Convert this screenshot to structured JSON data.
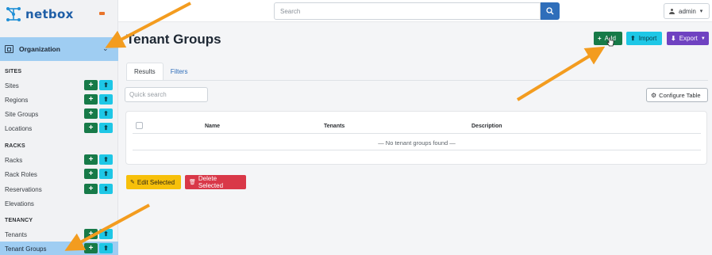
{
  "app": {
    "brand": "netbox"
  },
  "topbar": {
    "search_placeholder": "Search",
    "user": "admin"
  },
  "sidebar": {
    "menu_title": "Organization",
    "sections": [
      {
        "title": "SITES",
        "items": [
          "Sites",
          "Regions",
          "Site Groups",
          "Locations"
        ]
      },
      {
        "title": "RACKS",
        "items": [
          "Racks",
          "Rack Roles",
          "Reservations",
          "Elevations"
        ]
      },
      {
        "title": "TENANCY",
        "items": [
          "Tenants",
          "Tenant Groups"
        ]
      }
    ],
    "active_item": "Tenant Groups",
    "add_glyph": "+",
    "import_glyph": "⬆"
  },
  "page": {
    "title": "Tenant Groups",
    "actions": {
      "add": "Add",
      "import": "Import",
      "export": "Export"
    },
    "tabs": [
      "Results",
      "Filters"
    ],
    "quick_search_placeholder": "Quick search",
    "configure_table": "Configure Table",
    "table": {
      "columns": [
        "Name",
        "Tenants",
        "Description"
      ],
      "empty_message": "— No tenant groups found —"
    },
    "bulk": {
      "edit": "Edit Selected",
      "delete": "Delete Selected"
    }
  },
  "colors": {
    "brand": "#1f5fa7",
    "add": "#177a48",
    "import": "#1ec7e6",
    "export": "#6f42c1",
    "edit": "#f7c00a",
    "delete": "#d93848",
    "active_nav": "#9fcdf2",
    "annotation_arrow": "#f39c1f"
  }
}
